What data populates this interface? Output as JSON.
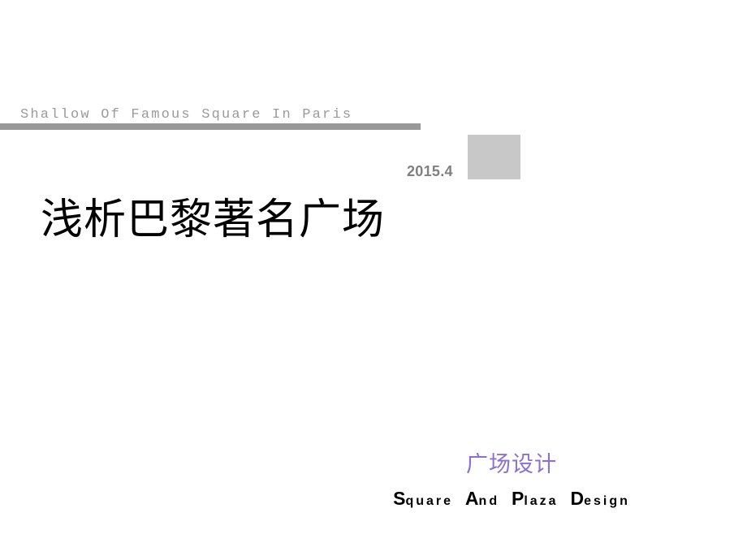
{
  "slide": {
    "kicker": "Shallow Of Famous Square In Paris",
    "date": "2015.4",
    "title": "浅析巴黎著名广场",
    "footer_cn": "广场设计",
    "footer_en_words": [
      {
        "cap": "S",
        "rest": "quare"
      },
      {
        "cap": "A",
        "rest": "nd"
      },
      {
        "cap": "P",
        "rest": "laza"
      },
      {
        "cap": "D",
        "rest": "esign"
      }
    ],
    "footer_en_plain": "Square And Plaza Design",
    "colors": {
      "rule": "#989898",
      "kicker_text": "#9a9a9a",
      "date_text": "#808080",
      "square_fill": "#c8c8c8",
      "footer_cn_text": "#8a6fd4",
      "title_text": "#000000",
      "background": "#ffffff"
    }
  }
}
